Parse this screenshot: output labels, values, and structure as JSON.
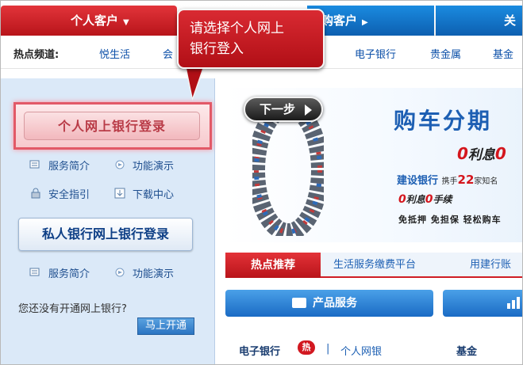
{
  "nav": {
    "personal_tab": "个人客户",
    "corporate_tab": "购客户",
    "third_tab": "关",
    "hot_label": "热点频道:",
    "hot_links": [
      "悦生活",
      "会",
      "电子银行",
      "贵金属",
      "基金"
    ]
  },
  "callout": {
    "line1": "请选择个人网上",
    "line2": "银行登入"
  },
  "left_panel": {
    "personal_login": "个人网上银行登录",
    "personal_links": [
      "服务简介",
      "功能演示",
      "安全指引",
      "下载中心"
    ],
    "private_login": "私人银行网上银行登录",
    "private_links": [
      "服务简介",
      "功能演示"
    ],
    "no_account_text": "您还没有开通网上银行?",
    "open_button": "马上开通"
  },
  "banner": {
    "next_button": "下一步",
    "title": "购车分期",
    "rate_zero": "0",
    "rate_text": "利息",
    "rate_zero2": "0",
    "bank_text": "建设银行",
    "bank_small1": "携手",
    "bank_count": "22",
    "bank_small2": "家知名",
    "fee_zero1": "0",
    "fee_text1": "利息",
    "fee_zero2": "0",
    "fee_text2": "手续",
    "terms": "免抵押 免担保 轻松购车"
  },
  "tabs": {
    "hot": "热点推荐",
    "life": "生活服务缴费平台",
    "ccb": "用建行账"
  },
  "products": {
    "label": "产品服务"
  },
  "bottom": {
    "ebank": "电子银行",
    "hot_badge": "热",
    "separator": "|",
    "personal_netbank": "个人网银",
    "fund": "基金"
  },
  "colors": {
    "brand_red": "#c8161d",
    "brand_blue": "#1a6bc4",
    "panel_blue": "#dbe9f8"
  }
}
